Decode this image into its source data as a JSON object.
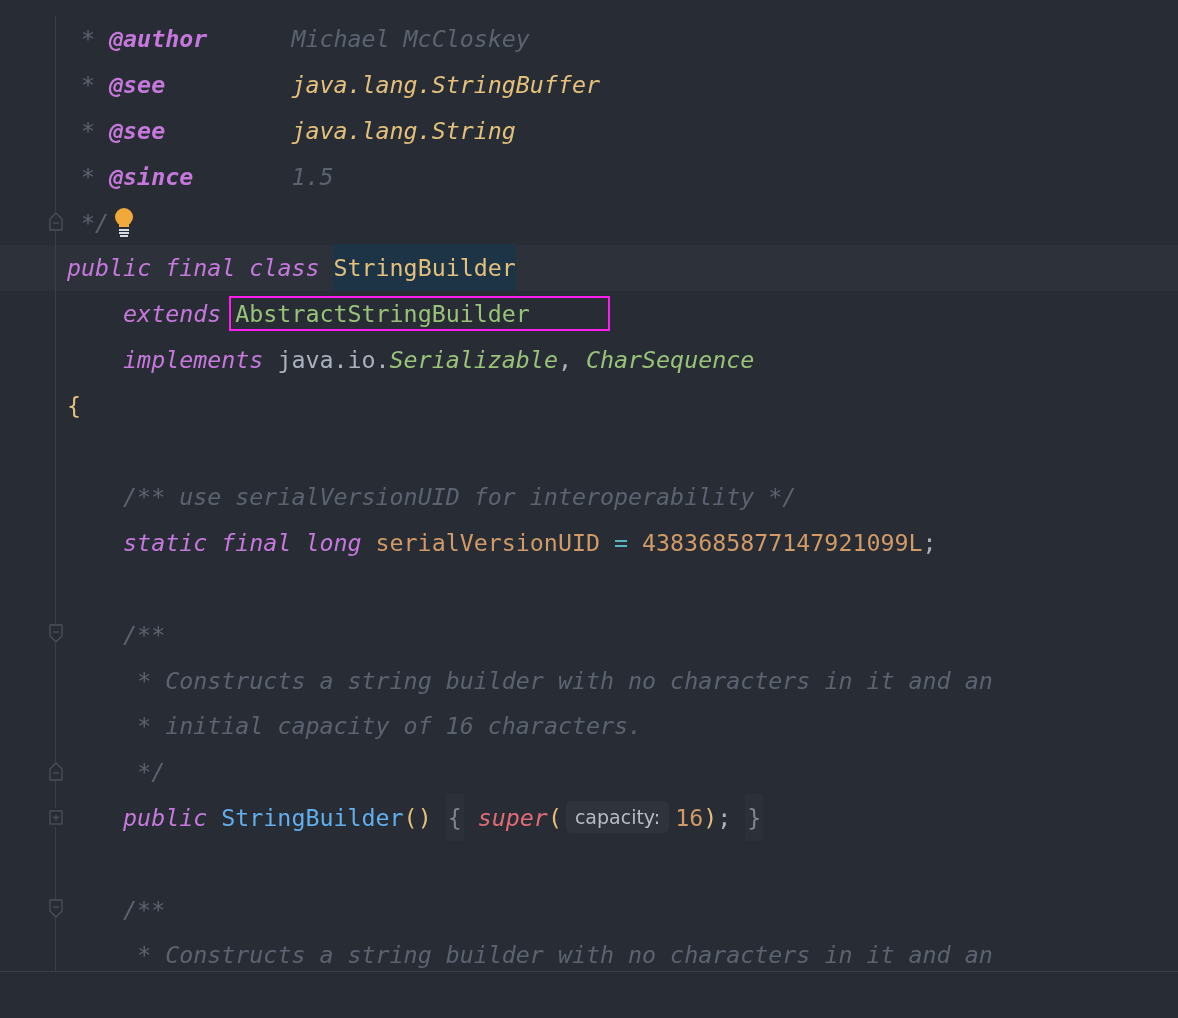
{
  "editor": {
    "lines": [
      {
        "kind": "doc-tag",
        "star": "*",
        "tag": "@author",
        "value": {
          "kind": "comment",
          "text": "Michael McCloskey"
        }
      },
      {
        "kind": "doc-tag",
        "star": "*",
        "tag": "@see",
        "value": {
          "kind": "docref",
          "text": "java.lang.StringBuffer"
        }
      },
      {
        "kind": "doc-tag",
        "star": "*",
        "tag": "@see",
        "value": {
          "kind": "docref",
          "text": "java.lang.String"
        }
      },
      {
        "kind": "doc-tag",
        "star": "*",
        "tag": "@since",
        "value": {
          "kind": "comment",
          "text": "1.5"
        }
      },
      {
        "kind": "doc",
        "fold": {
          "kind": "end"
        },
        "bulb": true,
        "words": [
          [
            {
              "kind": "comment",
              "text": "*/"
            }
          ]
        ]
      },
      {
        "kind": "top",
        "current": true,
        "words": [
          [
            {
              "kind": "keyword",
              "text": "public"
            }
          ],
          [
            {
              "kind": "keyword",
              "text": "final"
            }
          ],
          [
            {
              "kind": "keyword",
              "text": "class"
            }
          ],
          [
            {
              "kind": "declared-name",
              "text": "StringBuilder"
            }
          ]
        ]
      },
      {
        "kind": "member",
        "words": [
          [
            {
              "kind": "keyword",
              "text": "extends"
            }
          ],
          [
            {
              "kind": "marked-type",
              "text": "AbstractStringBuilder"
            }
          ]
        ]
      },
      {
        "kind": "member",
        "words": [
          [
            {
              "kind": "keyword",
              "text": "implements"
            }
          ],
          [
            {
              "kind": "plain",
              "text": "java.io."
            },
            {
              "kind": "interface",
              "text": "Serializable"
            },
            {
              "kind": "plain",
              "text": ","
            }
          ],
          [
            {
              "kind": "interface",
              "text": "CharSequence"
            }
          ]
        ]
      },
      {
        "kind": "top",
        "words": [
          [
            {
              "kind": "brace",
              "text": "{"
            }
          ]
        ]
      },
      {
        "kind": "empty"
      },
      {
        "kind": "member",
        "words": [
          [
            {
              "kind": "comment",
              "text": "/** use serialVersionUID for interoperability */"
            }
          ]
        ]
      },
      {
        "kind": "member",
        "words": [
          [
            {
              "kind": "keyword",
              "text": "static"
            }
          ],
          [
            {
              "kind": "keyword",
              "text": "final"
            }
          ],
          [
            {
              "kind": "keyword",
              "text": "long"
            }
          ],
          [
            {
              "kind": "field",
              "text": "serialVersionUID"
            }
          ],
          [
            {
              "kind": "operator",
              "text": "="
            }
          ],
          [
            {
              "kind": "number",
              "text": "4383685877147921099L"
            },
            {
              "kind": "plain",
              "text": ";"
            }
          ]
        ]
      },
      {
        "kind": "empty"
      },
      {
        "kind": "member",
        "fold": {
          "kind": "start"
        },
        "words": [
          [
            {
              "kind": "comment",
              "text": "/**"
            }
          ]
        ]
      },
      {
        "kind": "member-doc",
        "words": [
          [
            {
              "kind": "comment",
              "text": "* Constructs a string builder with no characters in it and an"
            }
          ]
        ]
      },
      {
        "kind": "member-doc",
        "words": [
          [
            {
              "kind": "comment",
              "text": "* initial capacity of 16 characters."
            }
          ]
        ]
      },
      {
        "kind": "member-doc",
        "fold": {
          "kind": "end"
        },
        "words": [
          [
            {
              "kind": "comment",
              "text": "*/"
            }
          ]
        ]
      },
      {
        "kind": "member",
        "fold": {
          "kind": "collapsed"
        },
        "words": [
          [
            {
              "kind": "keyword",
              "text": "public"
            }
          ],
          [
            {
              "kind": "method",
              "text": "StringBuilder"
            },
            {
              "kind": "paren",
              "text": "()"
            }
          ],
          [
            {
              "kind": "folded-brace",
              "text": "{"
            }
          ],
          [
            {
              "kind": "call",
              "text": "super"
            },
            {
              "kind": "paren",
              "text": "("
            },
            {
              "kind": "hint",
              "text": "capacity:"
            },
            {
              "kind": "number",
              "text": "16"
            },
            {
              "kind": "paren",
              "text": ")"
            },
            {
              "kind": "plain",
              "text": ";"
            }
          ],
          [
            {
              "kind": "folded-brace",
              "text": "}"
            }
          ]
        ]
      },
      {
        "kind": "empty"
      },
      {
        "kind": "member",
        "fold": {
          "kind": "start"
        },
        "words": [
          [
            {
              "kind": "comment",
              "text": "/**"
            }
          ]
        ]
      },
      {
        "kind": "member-doc",
        "words": [
          [
            {
              "kind": "comment",
              "text": "* Constructs a string builder with no characters in it and an"
            }
          ]
        ]
      }
    ]
  }
}
